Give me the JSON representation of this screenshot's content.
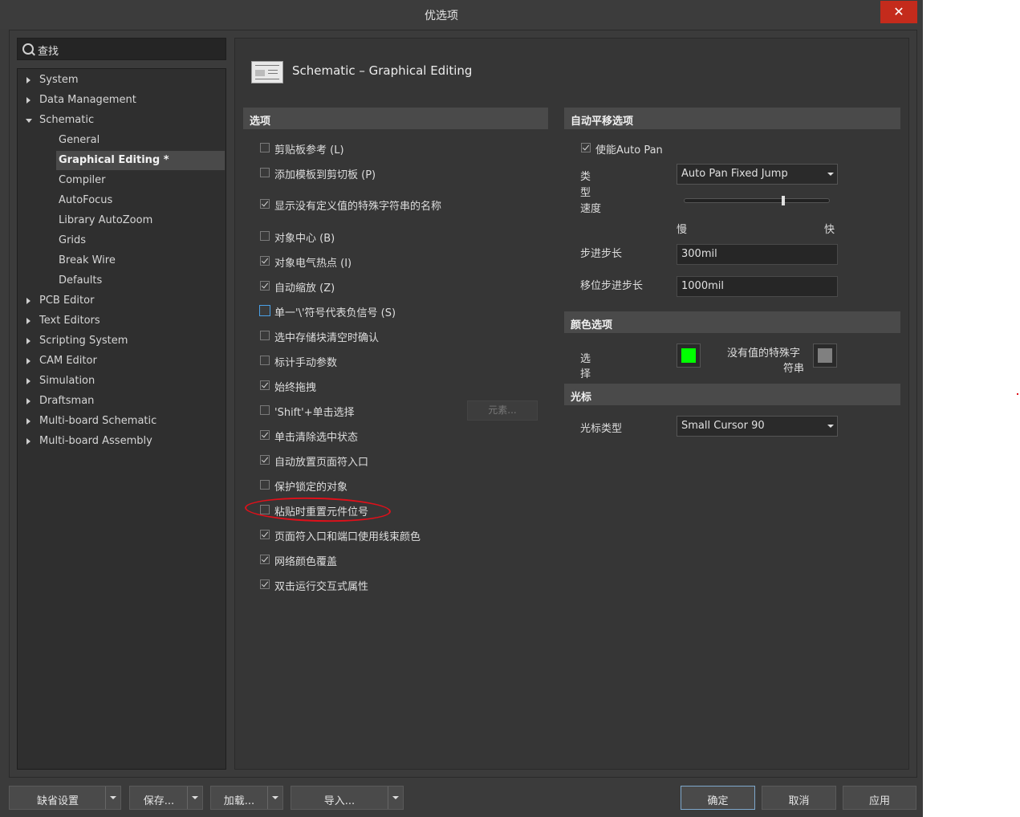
{
  "window": {
    "title": "优选项",
    "close": "✕"
  },
  "search": {
    "placeholder": "查找"
  },
  "tree": [
    {
      "label": "System",
      "level": 0,
      "arrow": "collapsed"
    },
    {
      "label": "Data Management",
      "level": 0,
      "arrow": "collapsed"
    },
    {
      "label": "Schematic",
      "level": 0,
      "arrow": "expanded"
    },
    {
      "label": "General",
      "level": 1
    },
    {
      "label": "Graphical Editing *",
      "level": 1,
      "selected": true
    },
    {
      "label": "Compiler",
      "level": 1
    },
    {
      "label": "AutoFocus",
      "level": 1
    },
    {
      "label": "Library AutoZoom",
      "level": 1
    },
    {
      "label": "Grids",
      "level": 1
    },
    {
      "label": "Break Wire",
      "level": 1
    },
    {
      "label": "Defaults",
      "level": 1
    },
    {
      "label": "PCB Editor",
      "level": 0,
      "arrow": "collapsed"
    },
    {
      "label": "Text Editors",
      "level": 0,
      "arrow": "collapsed"
    },
    {
      "label": "Scripting System",
      "level": 0,
      "arrow": "collapsed"
    },
    {
      "label": "CAM Editor",
      "level": 0,
      "arrow": "collapsed"
    },
    {
      "label": "Simulation",
      "level": 0,
      "arrow": "collapsed"
    },
    {
      "label": "Draftsman",
      "level": 0,
      "arrow": "collapsed"
    },
    {
      "label": "Multi-board Schematic",
      "level": 0,
      "arrow": "collapsed"
    },
    {
      "label": "Multi-board Assembly",
      "level": 0,
      "arrow": "collapsed"
    }
  ],
  "page": {
    "title": "Schematic – Graphical Editing"
  },
  "options": {
    "header": "选项",
    "items": [
      {
        "label": "剪贴板参考 (L)",
        "checked": false
      },
      {
        "label": "添加模板到剪切板 (P)",
        "checked": false
      },
      {
        "label": "显示没有定义值的特殊字符串的名称",
        "checked": true
      },
      {
        "label": "对象中心 (B)",
        "checked": false
      },
      {
        "label": "对象电气热点 (I)",
        "checked": true
      },
      {
        "label": "自动缩放 (Z)",
        "checked": true
      },
      {
        "label": "单一'\\'符号代表负信号 (S)",
        "checked": false,
        "focus": true
      },
      {
        "label": "选中存储块清空时确认",
        "checked": false
      },
      {
        "label": "标计手动参数",
        "checked": false
      },
      {
        "label": "始终拖拽",
        "checked": true
      },
      {
        "label": "'Shift'+单击选择",
        "checked": false
      },
      {
        "label": "单击清除选中状态",
        "checked": true
      },
      {
        "label": "自动放置页面符入口",
        "checked": true
      },
      {
        "label": "保护锁定的对象",
        "checked": false
      },
      {
        "label": "粘贴时重置元件位号",
        "checked": false
      },
      {
        "label": "页面符入口和端口使用线束颜色",
        "checked": true
      },
      {
        "label": "网络颜色覆盖",
        "checked": true
      },
      {
        "label": "双击运行交互式属性",
        "checked": true
      }
    ],
    "elements_button": "元素..."
  },
  "autopan": {
    "header": "自动平移选项",
    "enable_label": "使能Auto Pan",
    "enable_checked": true,
    "type_label_1": "类",
    "type_label_2": "型",
    "type_value": "Auto Pan Fixed Jump",
    "speed_label": "速度",
    "speed_level": 0.68,
    "slow_label": "慢",
    "fast_label": "快",
    "step_label": "步进步长",
    "step_value": "300mil",
    "shift_step_label": "移位步进步长",
    "shift_step_value": "1000mil"
  },
  "colors": {
    "header": "颜色选项",
    "selection_label_1": "选",
    "selection_label_2": "择",
    "selection_color": "#00ff00",
    "no_value_label_1": "没有值的特殊字",
    "no_value_label_2": "符串",
    "no_value_color": "#808080"
  },
  "cursor": {
    "header": "光标",
    "type_label": "光标类型",
    "type_value": "Small Cursor 90"
  },
  "footer": {
    "defaults": "缺省设置",
    "save": "保存...",
    "load": "加载...",
    "import": "导入...",
    "ok": "确定",
    "cancel": "取消",
    "apply": "应用"
  }
}
